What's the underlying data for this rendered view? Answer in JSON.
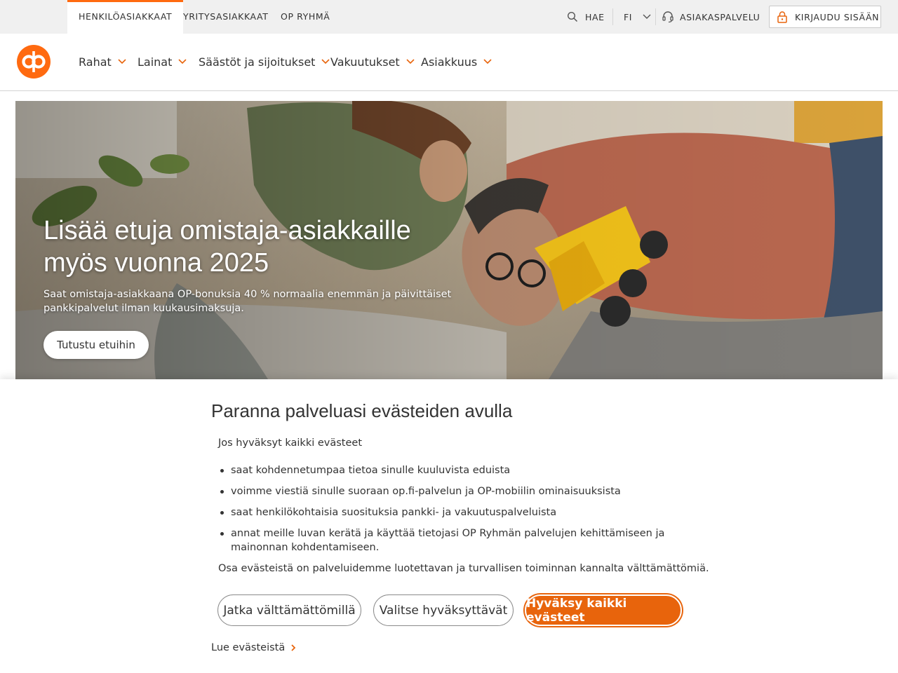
{
  "topbar": {
    "tabs": [
      "HENKILÖASIAKKAAT",
      "YRITYSASIAKKAAT",
      "OP RYHMÄ"
    ],
    "search_label": "HAE",
    "language": "FI",
    "customer_service": "ASIAKASPALVELU",
    "login_label": "KIRJAUDU SISÄÄN"
  },
  "nav": {
    "items": [
      "Rahat",
      "Lainat",
      "Säästöt ja sijoitukset",
      "Vakuutukset",
      "Asiakkuus"
    ]
  },
  "hero": {
    "title_line1": "Lisää etuja omistaja-asiakkaille",
    "title_line2": "myös vuonna 2025",
    "text": "Saat omistaja-asiakkaana OP-bonuksia 40 % normaalia enemmän ja päivittäiset pankkipalvelut ilman kuukausimaksuja.",
    "button": "Tutustu etuihin"
  },
  "cookie": {
    "title": "Paranna palveluasi evästeiden avulla",
    "intro": "Jos hyväksyt kaikki evästeet",
    "bullets": [
      "saat kohdennetumpaa tietoa sinulle kuuluvista eduista",
      "voimme viestiä sinulle suoraan op.fi-palvelun ja OP-mobiilin ominaisuuksista",
      "saat henkilökohtaisia suosituksia pankki- ja vakuutuspalveluista",
      "annat meille luvan kerätä ja käyttää tietojasi OP Ryhmän palvelujen kehittämiseen ja mainonnan kohdentamiseen."
    ],
    "note": "Osa evästeistä on palveluidemme luotettavan ja turvallisen toiminnan kannalta välttämättömiä.",
    "btn_necessary": "Jatka välttämättömillä",
    "btn_choose": "Valitse hyväksyttävät",
    "btn_accept": "Hyväksy kaikki evästeet",
    "read_more": "Lue evästeistä"
  },
  "colors": {
    "brand_orange": "#ff6a10",
    "accept_orange": "#e8640c"
  },
  "icons": [
    "search-icon",
    "chevron-down-icon",
    "headset-icon",
    "lock-icon",
    "op-logo",
    "chevron-right-icon"
  ]
}
